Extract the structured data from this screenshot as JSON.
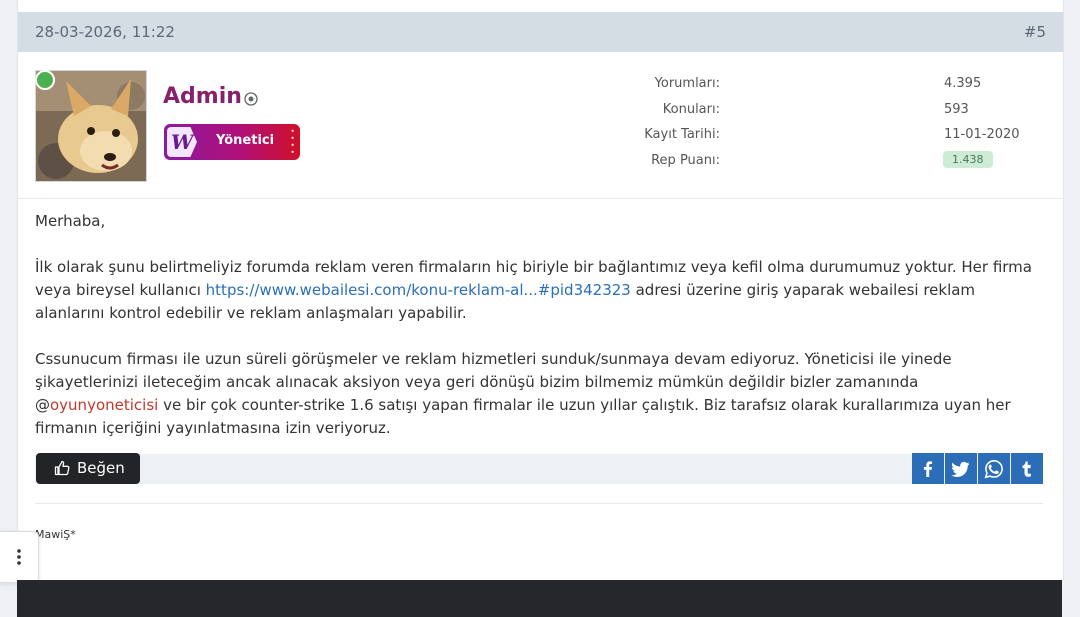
{
  "post": {
    "date": "28-03-2026, 11:22",
    "number": "#5",
    "author": {
      "name": "Admin",
      "rank": "Yönetici",
      "rank_logo_letter": "W",
      "online": true,
      "avatar": "dog-photo"
    },
    "stats": [
      {
        "label": "Yorumları:",
        "value": "4.395"
      },
      {
        "label": "Konuları:",
        "value": "593"
      },
      {
        "label": "Kayıt Tarihi:",
        "value": "11-01-2020"
      },
      {
        "label": "Rep Puanı:",
        "value": "1.438"
      }
    ],
    "body": {
      "greeting": "Merhaba,",
      "p1_a": "İlk olarak şunu belirtmeliyiz forumda reklam veren firmaların hiç biriyle bir bağlantımız veya kefil olma durumumuz yoktur. Her firma veya bireysel kullanıcı ",
      "p1_link": "https://www.webailesi.com/konu-reklam-al...#pid342323",
      "p1_b": " adresi üzerine giriş yaparak webailesi reklam alanlarını kontrol edebilir ve reklam anlaşmaları yapabilir.",
      "p2_a": "Cssunucum firması ile uzun süreli görüşmeler ve reklam hizmetleri sunduk/sunmaya devam ediyoruz. Yöneticisi ile yinede şikayetlerinizi ileteceğim ancak alınacak aksiyon veya geri dönüşü bizim bilmemiz mümkün değildir bizler zamanında @",
      "p2_mention": "oyunyoneticisi",
      "p2_b": " ve bir çok counter-strike 1.6 satışı yapan firmalar ile uzun yıllar çalıştık. Biz tarafsız olarak kurallarımıza uyan her firmanın içeriğini yayınlatmasına izin veriyoruz."
    },
    "actions": {
      "like_label": "Beğen",
      "share": [
        "facebook-icon",
        "twitter-icon",
        "whatsapp-icon",
        "tumblr-icon"
      ]
    },
    "signature": "MawiŞ*"
  },
  "colors": {
    "header_bg": "#d4dce4",
    "author_name": "#8a1f6b",
    "link": "#2a6fb8",
    "mention": "#c0392b",
    "share_bg": "#2c6db8",
    "like_bg": "#222427",
    "online": "#4caf50"
  }
}
